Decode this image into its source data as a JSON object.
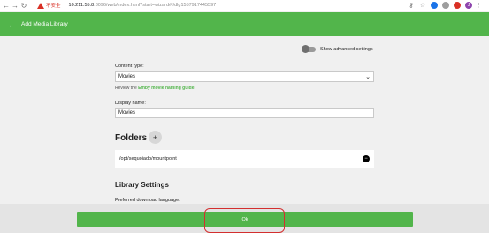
{
  "browser": {
    "back": "←",
    "forward": "→",
    "reload": "↻",
    "insecure_label": "不安全",
    "url_host": "10.211.55.8",
    "url_rest": ":8096/web/index.html?start=wizard#!/dlg1557917445597",
    "extensions": [
      {
        "icon": "key-icon",
        "glyph": "⚷"
      },
      {
        "icon": "star-icon",
        "glyph": "☆"
      },
      {
        "icon": "blue-extension-icon",
        "glyph": "●",
        "color": "#1a73e8"
      },
      {
        "icon": "gray-extension-icon",
        "glyph": "●",
        "color": "#9e9e9e"
      },
      {
        "icon": "red-extension-icon",
        "glyph": "●",
        "color": "#d93025"
      },
      {
        "icon": "profile-avatar-icon",
        "glyph": "J",
        "color": "#8e44ad"
      }
    ],
    "menu": "⋮"
  },
  "header": {
    "back_icon": "←",
    "title": "Add Media Library",
    "color": "#52b54b"
  },
  "advanced": {
    "label": "Show advanced settings"
  },
  "content_type": {
    "label": "Content type:",
    "value": "Movies",
    "hint_prefix": "Review the ",
    "hint_link": "Emby movie naming guide",
    "hint_suffix": "."
  },
  "display_name": {
    "label": "Display name:",
    "value": "Movies"
  },
  "folders": {
    "title": "Folders",
    "add_icon": "+",
    "items": [
      {
        "path": "/opt/sequoiadb/mountpoint",
        "remove_icon": "−"
      }
    ]
  },
  "library_settings": {
    "title": "Library Settings",
    "download_language_label": "Preferred download language:"
  },
  "footer": {
    "ok_label": "Ok",
    "annotation_color": "#d32f2f"
  }
}
